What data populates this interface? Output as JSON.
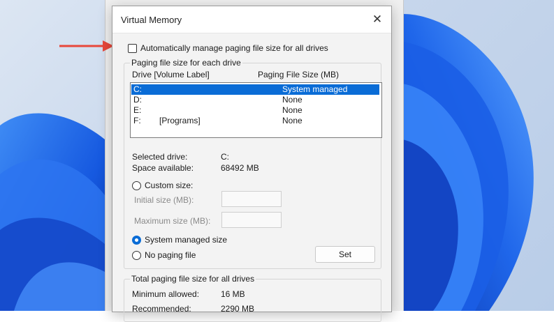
{
  "window": {
    "title": "Virtual Memory",
    "close_glyph": "✕"
  },
  "auto_manage": {
    "label": "Automatically manage paging file size for all drives",
    "checked": false
  },
  "paging_group": {
    "title": "Paging file size for each drive",
    "col_drive": "Drive  [Volume Label]",
    "col_size": "Paging File Size (MB)",
    "drives": [
      {
        "drive": "C:",
        "label": "",
        "size": "System managed",
        "selected": true
      },
      {
        "drive": "D:",
        "label": "",
        "size": "None",
        "selected": false
      },
      {
        "drive": "E:",
        "label": "",
        "size": "None",
        "selected": false
      },
      {
        "drive": "F:",
        "label": "[Programs]",
        "size": "None",
        "selected": false
      }
    ],
    "selected_drive_label": "Selected drive:",
    "selected_drive_value": "C:",
    "space_available_label": "Space available:",
    "space_available_value": "68492 MB",
    "custom_size_label": "Custom size:",
    "initial_size_label": "Initial size (MB):",
    "maximum_size_label": "Maximum size (MB):",
    "system_managed_label": "System managed size",
    "no_paging_label": "No paging file",
    "set_button": "Set",
    "selected_option": "System managed size"
  },
  "total_group": {
    "title": "Total paging file size for all drives",
    "minimum_label": "Minimum allowed:",
    "minimum_value": "16 MB",
    "recommended_label": "Recommended:",
    "recommended_value": "2290 MB"
  },
  "colors": {
    "accent": "#0a6cd6",
    "arrow": "#e8473a"
  }
}
